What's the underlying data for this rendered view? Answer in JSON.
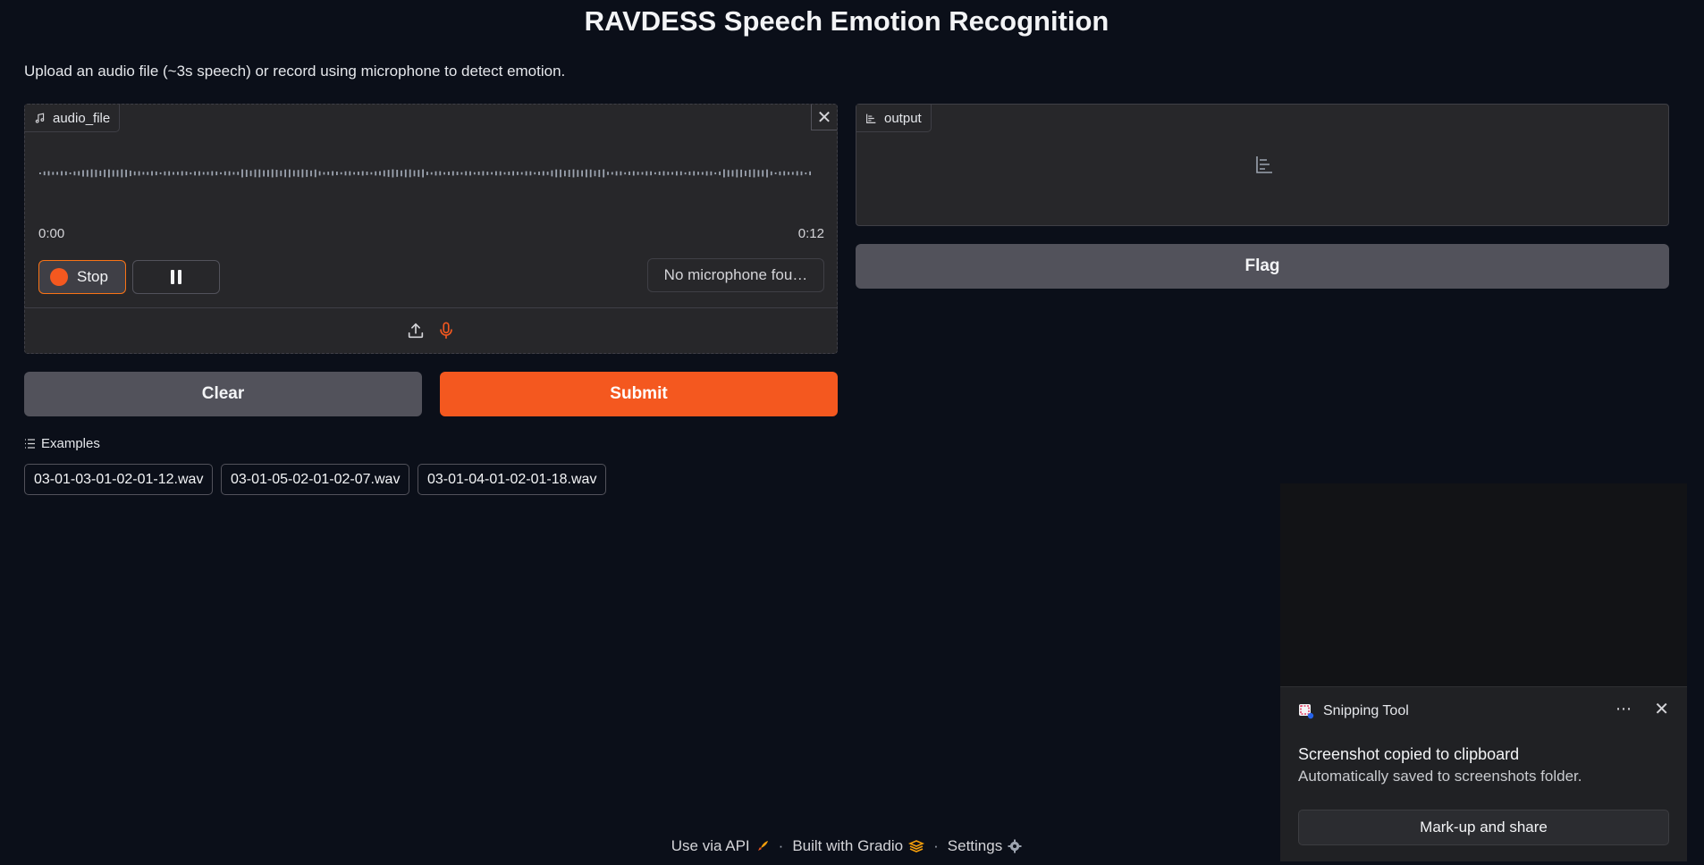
{
  "page": {
    "title": "RAVDESS Speech Emotion Recognition",
    "description": "Upload an audio file (~3s speech) or record using microphone to detect emotion."
  },
  "audio_input": {
    "label": "audio_file",
    "icon": "music-note-icon",
    "time_start": "0:00",
    "time_end": "0:12",
    "stop_label": "Stop",
    "microphone_select": "No microphone fou…",
    "sources": [
      "upload-icon",
      "microphone-icon"
    ]
  },
  "output": {
    "label": "output",
    "icon": "bar-chart-icon"
  },
  "buttons": {
    "clear": "Clear",
    "submit": "Submit",
    "flag": "Flag"
  },
  "examples": {
    "label": "Examples",
    "items": [
      "03-01-03-01-02-01-12.wav",
      "03-01-05-02-01-02-07.wav",
      "03-01-04-01-02-01-18.wav"
    ]
  },
  "footer": {
    "api": "Use via API",
    "built": "Built with Gradio",
    "settings": "Settings"
  },
  "notification": {
    "app": "Snipping Tool",
    "more": "⋯",
    "title": "Screenshot copied to clipboard",
    "body": "Automatically saved to screenshots folder.",
    "action": "Mark-up and share"
  },
  "colors": {
    "accent": "#f4581f",
    "background": "#0b0f19",
    "panel": "#27272a"
  }
}
